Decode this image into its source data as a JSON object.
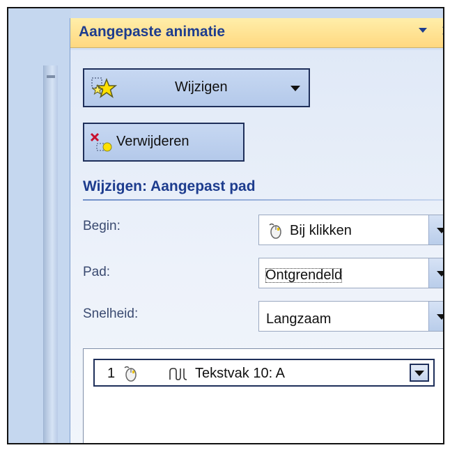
{
  "panel": {
    "title": "Aangepaste animatie",
    "title_menu_icon": "dropdown-arrow",
    "title_close": "✕"
  },
  "toolbar": {
    "change_label": "Wijzigen",
    "change_icon": "star-effect-icon",
    "remove_label": "Verwijderen",
    "remove_icon": "remove-effect-icon"
  },
  "section": {
    "title": "Wijzigen: Aangepast pad"
  },
  "fields": {
    "start_label": "Begin:",
    "start_value": "Bij klikken",
    "path_label": "Pad:",
    "path_value": "Ontgrendeld",
    "speed_label": "Snelheid:",
    "speed_value": "Langzaam"
  },
  "animation_list": [
    {
      "index": "1",
      "trigger_icon": "mouse-icon",
      "path_icon": "custom-path-icon",
      "name": "Tekstvak 10: A"
    }
  ],
  "colors": {
    "title_text": "#1d3c8e",
    "titlebar": "#ffd880",
    "panel_bg": "#e0e9f7"
  }
}
